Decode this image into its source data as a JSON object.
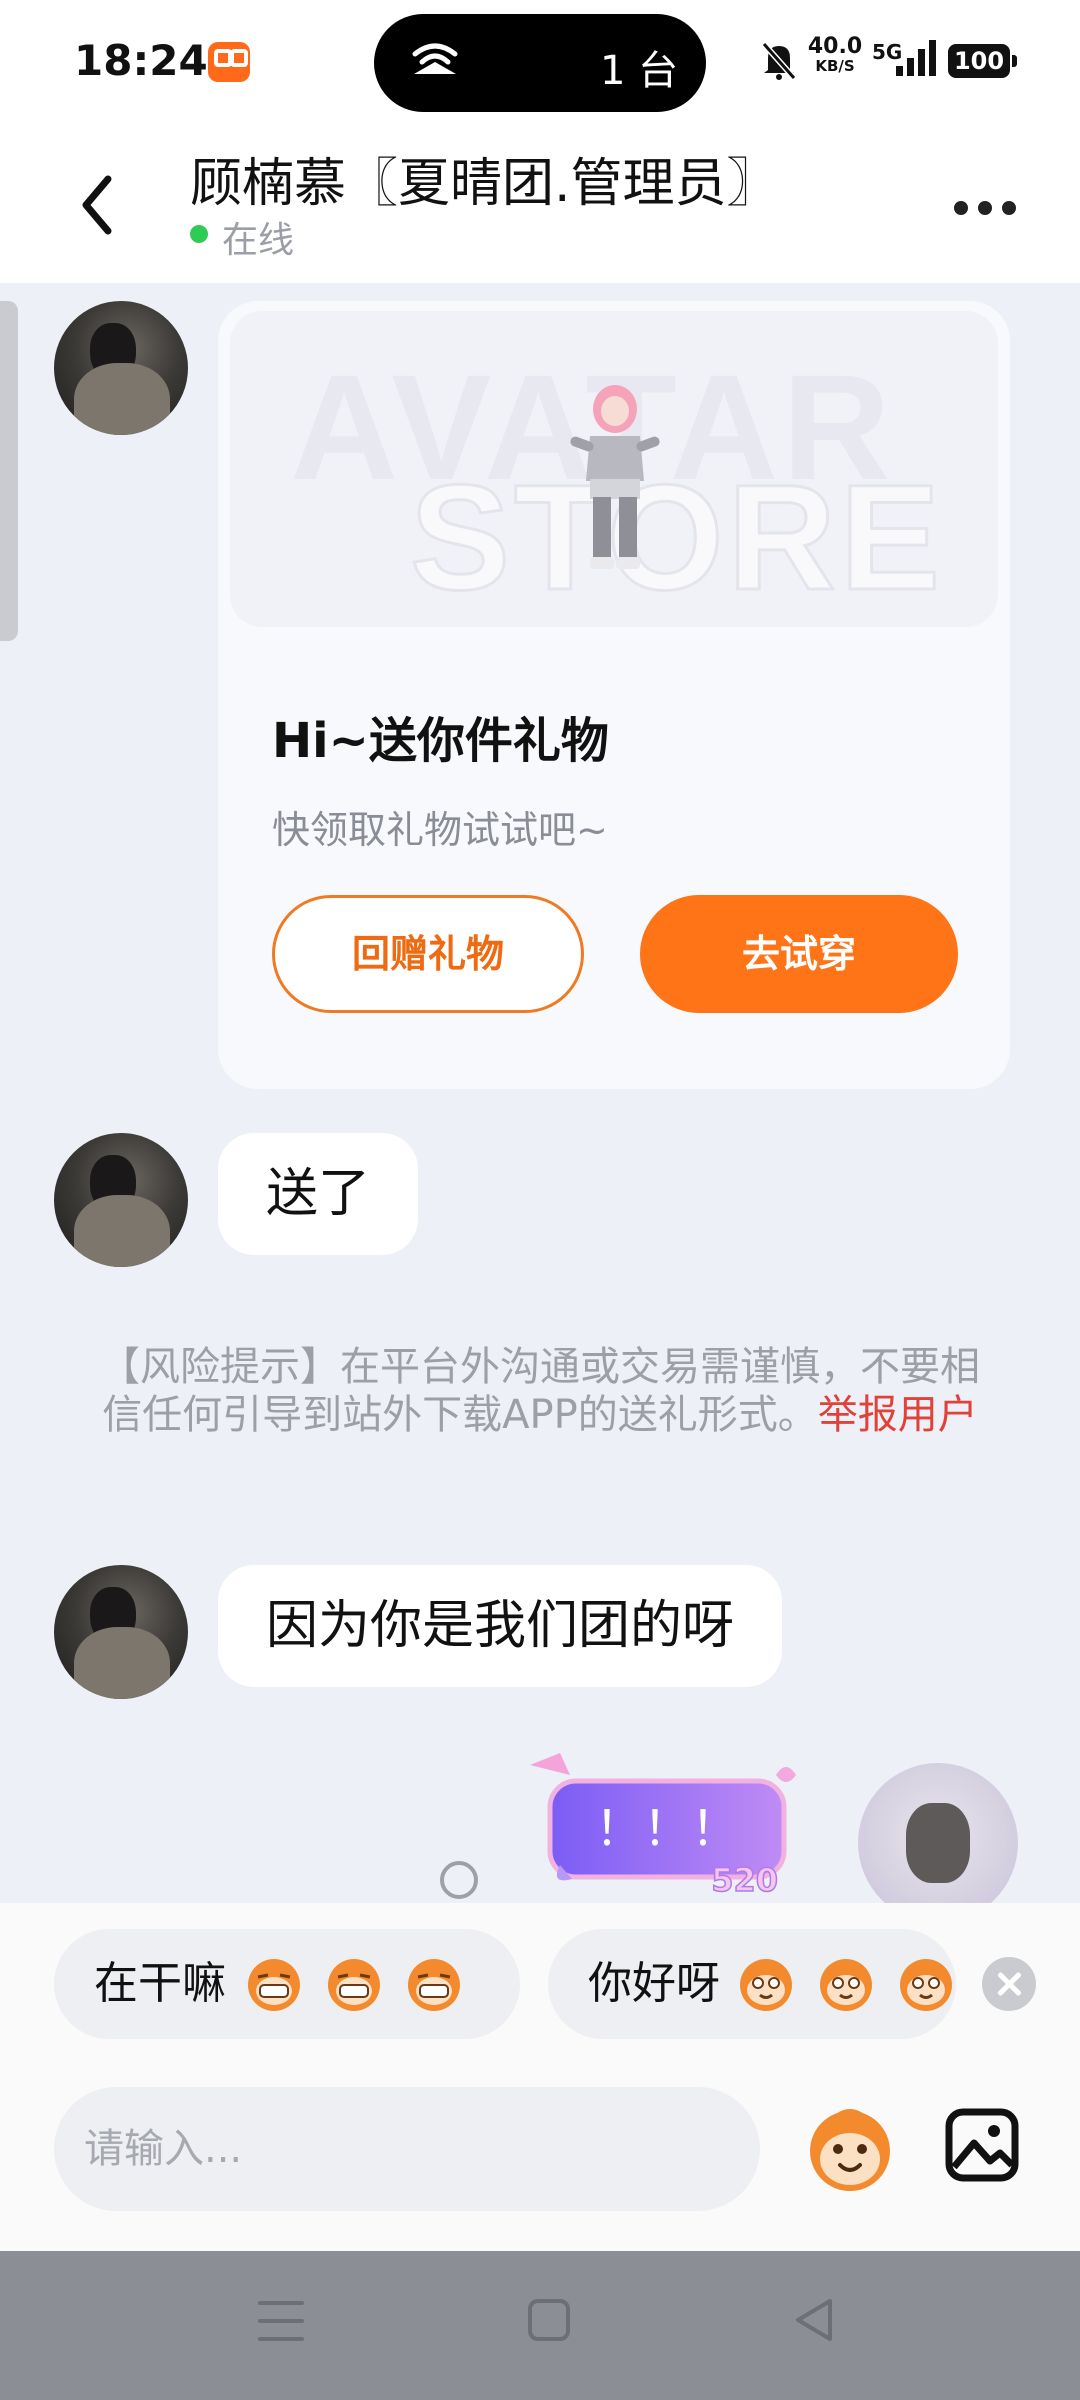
{
  "status_bar": {
    "time": "18:24",
    "island_text": "1 台",
    "net_speed": "40.0",
    "net_unit": "KB/S",
    "network_type": "5G",
    "battery": "100"
  },
  "header": {
    "title": "顾楠慕〖夏晴团.管理员〗",
    "status": "在线",
    "icons": [
      "chevron-left-icon",
      "more-horizontal-icon"
    ]
  },
  "gift_card": {
    "banner_text_1": "AVATAR",
    "banner_text_2": "STORE",
    "title": "Hi~送你件礼物",
    "subtitle": "快领取礼物试试吧~",
    "return_button": "回赠礼物",
    "try_button": "去试穿"
  },
  "messages": [
    {
      "sender": "other",
      "text": "送了"
    },
    {
      "sender": "other",
      "text": "因为你是我们团的呀"
    }
  ],
  "risk_notice": {
    "text": "【风险提示】在平台外沟通或交易需谨慎，不要相信任何引导到站外下载APP的送礼形式。",
    "link": "举报用户"
  },
  "sticker": {
    "text": "！！！",
    "number": "520"
  },
  "quick_replies": [
    {
      "text": "在干嘛"
    },
    {
      "text": "你好呀"
    }
  ],
  "input": {
    "placeholder": "请输入..."
  },
  "colors": {
    "accent": "#ff7416",
    "online": "#2fcb55",
    "report_link": "#e0423a"
  }
}
